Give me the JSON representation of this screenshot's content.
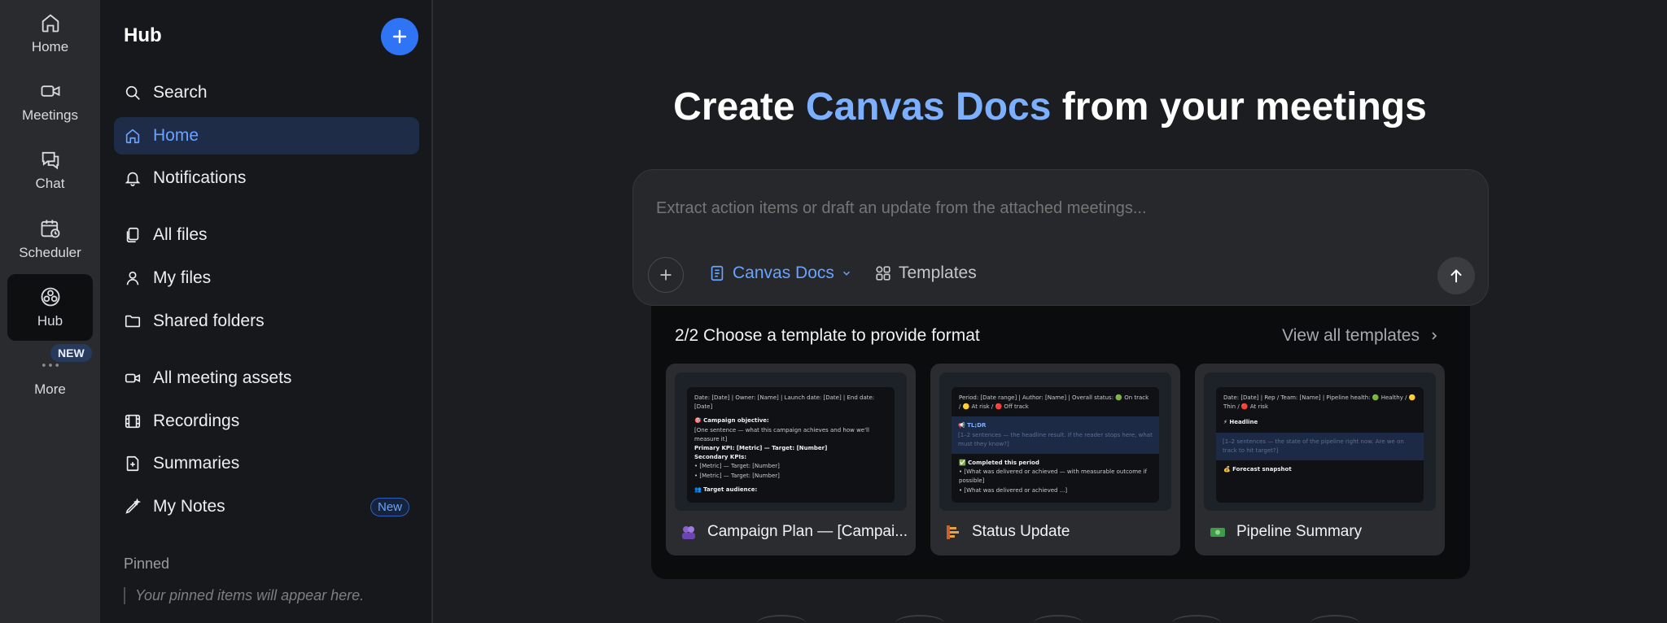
{
  "rail": {
    "items": [
      {
        "label": "Home",
        "icon": "home-icon"
      },
      {
        "label": "Meetings",
        "icon": "video-icon"
      },
      {
        "label": "Chat",
        "icon": "chat-icon"
      },
      {
        "label": "Scheduler",
        "icon": "calendar-clock-icon"
      },
      {
        "label": "Hub",
        "icon": "hub-icon"
      },
      {
        "label": "More",
        "icon": "more-dots-icon"
      }
    ],
    "badge": "NEW",
    "active": "Hub"
  },
  "hub": {
    "title": "Hub",
    "nav": [
      {
        "label": "Search",
        "icon": "search-icon"
      },
      {
        "label": "Home",
        "icon": "home-icon",
        "active": true
      },
      {
        "label": "Notifications",
        "icon": "bell-icon"
      },
      {
        "label": "All files",
        "icon": "files-icon"
      },
      {
        "label": "My files",
        "icon": "user-icon"
      },
      {
        "label": "Shared folders",
        "icon": "folder-icon"
      },
      {
        "label": "All meeting assets",
        "icon": "video-icon"
      },
      {
        "label": "Recordings",
        "icon": "film-icon"
      },
      {
        "label": "Summaries",
        "icon": "summary-icon"
      },
      {
        "label": "My Notes",
        "icon": "pen-sparkle-icon",
        "badge": "New"
      }
    ],
    "pinned_heading": "Pinned",
    "pinned_empty": "Your pinned items will appear here."
  },
  "main": {
    "headline_pre": "Create ",
    "headline_accent": "Canvas Docs",
    "headline_post": " from your meetings",
    "composer": {
      "placeholder": "Extract action items or draft an update from the attached meetings...",
      "mode": "Canvas Docs",
      "templates": "Templates"
    },
    "templates": {
      "heading": "2/2 Choose a template to provide format",
      "view_all": "View all templates",
      "cards": [
        {
          "title": "Campaign Plan — [Campai...",
          "preview": {
            "meta": "Date: [Date] | Owner: [Name] | Launch date: [Date] | End date: [Date]",
            "h1": "🎯 Campaign objective:",
            "p1": "[One sentence — what this campaign achieves and how we'll measure it]",
            "p2": "Primary KPI: [Metric] — Target: [Number]",
            "p3": "Secondary KPIs:",
            "li1": "[Metric] — Target: [Number]",
            "li2": "[Metric] — Target: [Number]",
            "h2": "👥 Target audience:"
          }
        },
        {
          "title": "Status Update",
          "preview": {
            "meta": "Period: [Date range] | Author: [Name] | Overall status: 🟢 On track / 🟡 At risk / 🔴 Off track",
            "hl_title": "📢 TL;DR",
            "hl_body": "[1–2 sentences — the headline result. If the reader stops here, what must they know?]",
            "h1": "✅ Completed this period",
            "li1": "[What was delivered or achieved — with measurable outcome if possible]",
            "li2": "[What was delivered or achieved ...]"
          }
        },
        {
          "title": "Pipeline Summary",
          "preview": {
            "meta": "Date: [Date] | Rep / Team: [Name] | Pipeline health: 🟢 Healthy / 🟡 Thin / 🔴 At risk",
            "h1": "⚡ Headline",
            "hl_body": "[1–2 sentences — the state of the pipeline right now. Are we on track to hit target?]",
            "h2": "💰 Forecast snapshot"
          }
        }
      ]
    }
  },
  "colors": {
    "accent": "#2f74f5",
    "accent_text": "#7cb0ff",
    "background": "#1b1d20"
  }
}
